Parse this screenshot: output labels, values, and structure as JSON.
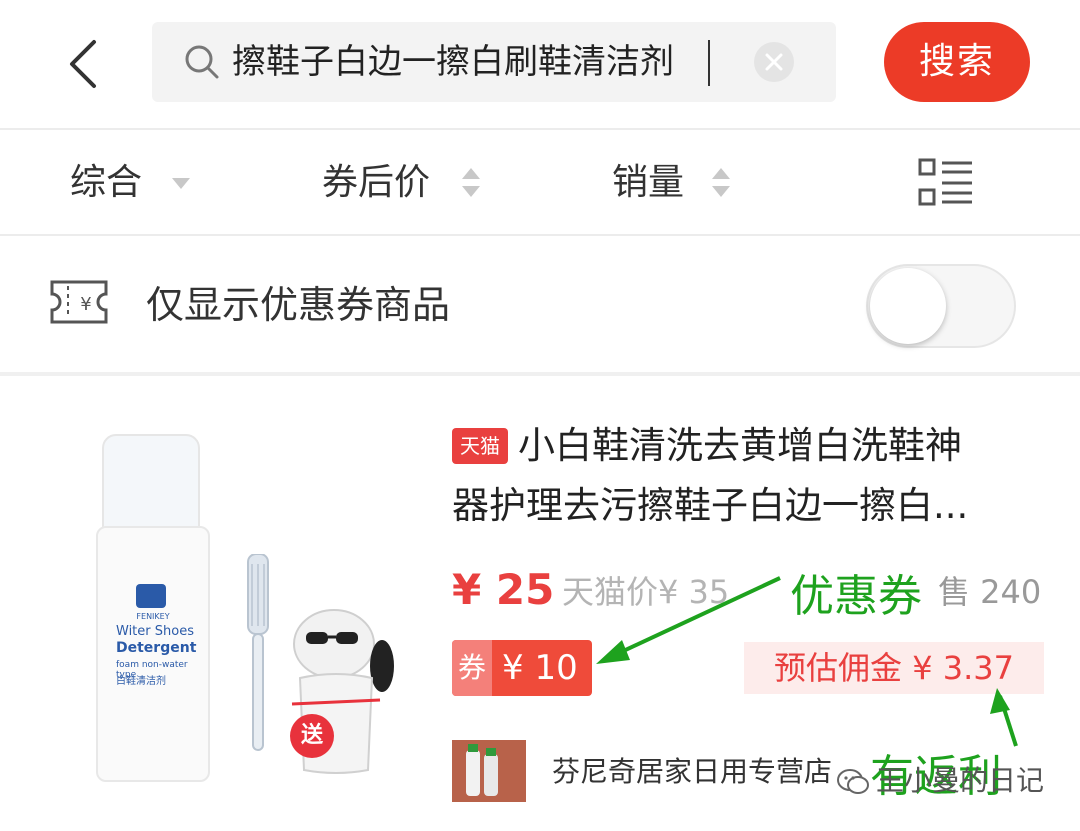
{
  "search": {
    "query": "擦鞋子白边一擦白刷鞋清洁剂",
    "button_label": "搜索"
  },
  "sort": {
    "items": [
      {
        "label": "综合"
      },
      {
        "label": "券后价"
      },
      {
        "label": "销量"
      }
    ]
  },
  "filter": {
    "coupon_only_label": "仅显示优惠券商品",
    "coupon_only_enabled": false
  },
  "product": {
    "platform_badge": "天猫",
    "title_line1": "小白鞋清洗去黄增白洗鞋神",
    "title_line2": "器护理去污擦鞋子白边一擦白...",
    "price": "¥ 25",
    "original_price": "天猫价¥ 35",
    "sales": "售 240",
    "coupon_tag": "券",
    "coupon_amount": "¥ 10",
    "commission": "预估佣金 ¥ 3.37",
    "shop_name": "芬尼奇居家日用专营店",
    "image_text": {
      "brand": "FENIKEY",
      "name_en_1": "Witer Shoes",
      "name_en_2": "Detergent",
      "sub_en": "foam non-water type",
      "name_cn": "白鞋清洁剂",
      "gift": "送"
    }
  },
  "annotations": {
    "coupon_note": "优惠券",
    "rebate_note": "有返利",
    "color": "#1ea21e"
  },
  "watermark": {
    "text": "王小曼的日记"
  },
  "colors": {
    "accent": "#ec3b27",
    "price": "#e9403f"
  }
}
